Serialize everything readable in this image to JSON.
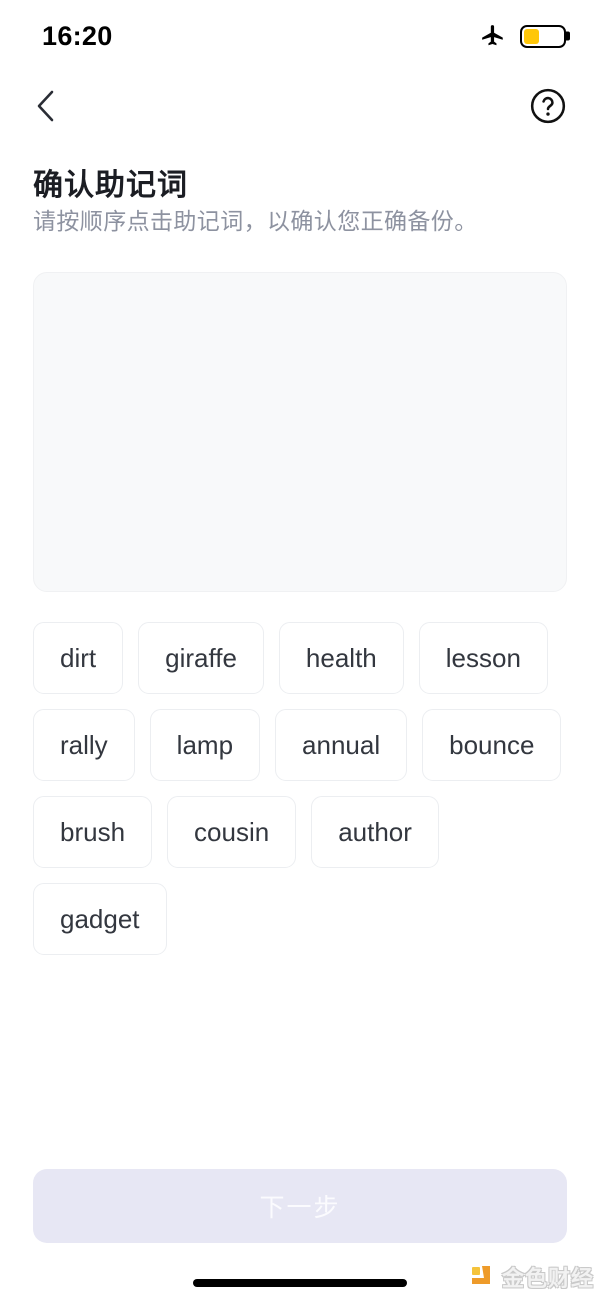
{
  "status_bar": {
    "time": "16:20",
    "airplane_icon": "airplane-mode-icon",
    "battery_icon": "battery-low-power-icon",
    "battery_level_percent": 40,
    "battery_color": "#FFC709"
  },
  "nav": {
    "back_icon": "chevron-left-icon",
    "help_icon": "question-mark-circle-icon"
  },
  "header": {
    "title": "确认助记词",
    "subtitle": "请按顺序点击助记词，以确认您正确备份。"
  },
  "answer_area": {
    "selected_words": [],
    "background_color": "#f8f9fa"
  },
  "word_pool": {
    "words": [
      "dirt",
      "giraffe",
      "health",
      "lesson",
      "rally",
      "lamp",
      "annual",
      "bounce",
      "brush",
      "cousin",
      "author",
      "gadget"
    ]
  },
  "footer": {
    "next_label": "下一步",
    "next_disabled": true,
    "next_background_color": "#e7e7f4"
  },
  "watermark": {
    "brand": "金色财经",
    "logo_icon": "jinse-logo-icon",
    "logo_color": "#F0A93B"
  }
}
